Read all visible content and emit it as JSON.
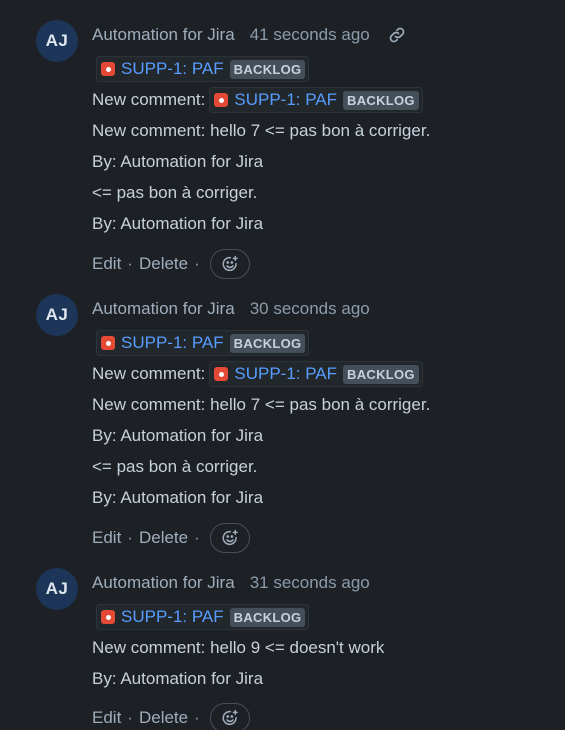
{
  "comments": [
    {
      "avatar": "AJ",
      "author": "Automation for Jira",
      "time": "41 seconds ago",
      "show_link_icon": true,
      "issue": {
        "key_summary": "SUPP-1: PAF",
        "status": "BACKLOG"
      },
      "new_comment_label": "New comment:",
      "lines": [
        "New comment: hello 7 <= pas bon à corriger.",
        "By: Automation for Jira",
        "<= pas bon à corriger.",
        "By: Automation for Jira"
      ],
      "actions": {
        "edit": "Edit",
        "delete": "Delete",
        "sep": "·"
      }
    },
    {
      "avatar": "AJ",
      "author": "Automation for Jira",
      "time": "30 seconds ago",
      "show_link_icon": false,
      "issue": {
        "key_summary": "SUPP-1: PAF",
        "status": "BACKLOG"
      },
      "new_comment_label": "New comment:",
      "lines": [
        "New comment: hello 7 <= pas bon à corriger.",
        "By: Automation for Jira",
        "<= pas bon à corriger.",
        "By: Automation for Jira"
      ],
      "actions": {
        "edit": "Edit",
        "delete": "Delete",
        "sep": "·"
      }
    },
    {
      "avatar": "AJ",
      "author": "Automation for Jira",
      "time": "31 seconds ago",
      "show_link_icon": false,
      "issue": {
        "key_summary": "SUPP-1: PAF",
        "status": "BACKLOG"
      },
      "lines": [
        "New comment: hello 9 <= doesn't work",
        "By: Automation for Jira"
      ],
      "actions": {
        "edit": "Edit",
        "delete": "Delete",
        "sep": "·"
      }
    }
  ],
  "icons": {
    "link": "link-icon",
    "issue_type": "bug-icon",
    "reaction": "add-reaction-icon"
  },
  "colors": {
    "background": "#1d2125",
    "link": "#579dff",
    "issue_type": "#e34935",
    "avatar": "#1c3558",
    "lozenge": "#454f59"
  }
}
